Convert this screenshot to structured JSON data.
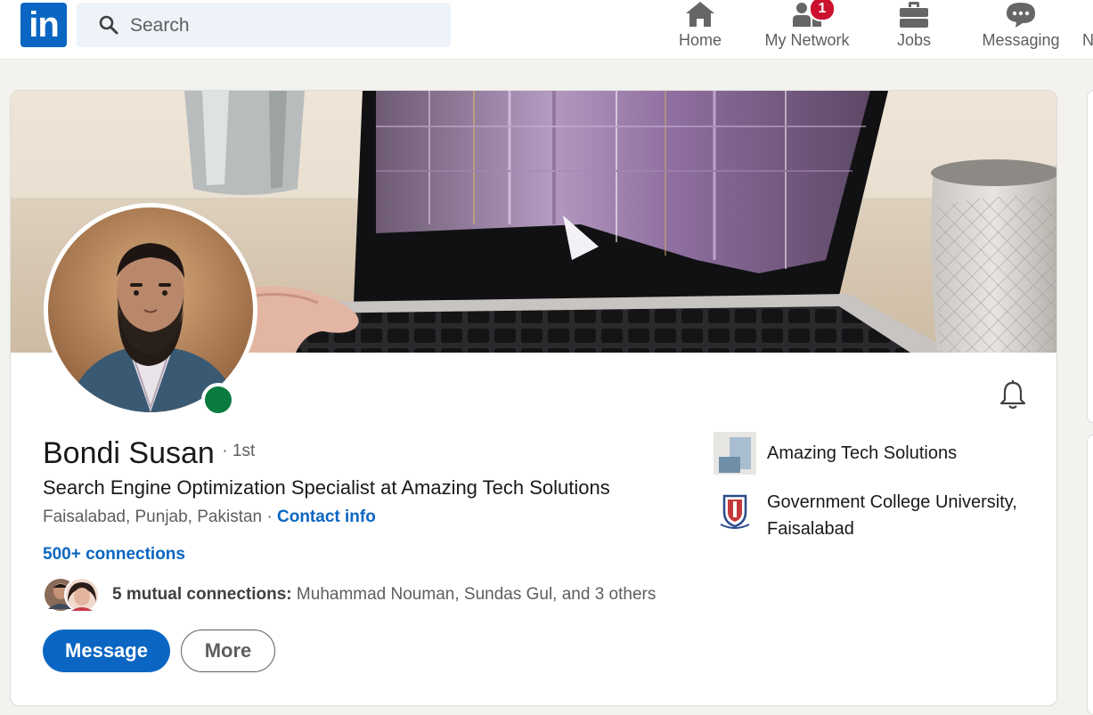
{
  "nav": {
    "logo_text": "in",
    "search_placeholder": "Search",
    "items": [
      {
        "label": "Home",
        "icon": "home-icon"
      },
      {
        "label": "My Network",
        "icon": "network-icon",
        "badge": "1"
      },
      {
        "label": "Jobs",
        "icon": "briefcase-icon"
      },
      {
        "label": "Messaging",
        "icon": "messaging-icon"
      }
    ],
    "cut_label": "N"
  },
  "profile": {
    "name": "Bondi Susan",
    "degree": "· 1st",
    "headline": "Search Engine Optimization Specialist at Amazing Tech Solutions",
    "location": "Faisalabad, Punjab, Pakistan",
    "separator": " · ",
    "contact_label": "Contact info",
    "connections": "500+ connections",
    "mutual_count": "5 mutual connections:",
    "mutual_names": "Muhammad Nouman, Sundas Gul, and 3 others",
    "online": true
  },
  "actions": {
    "primary_label": "Message",
    "secondary_label": "More"
  },
  "organizations": [
    {
      "name": "Amazing Tech Solutions",
      "icon": "company-logo-icon"
    },
    {
      "name": "Government College University, Faisalabad",
      "icon": "university-crest-icon"
    }
  ],
  "colors": {
    "brand": "#0a66c2",
    "badge": "#cb112d",
    "online": "#0a7b3e",
    "background": "#f4f2ee"
  }
}
